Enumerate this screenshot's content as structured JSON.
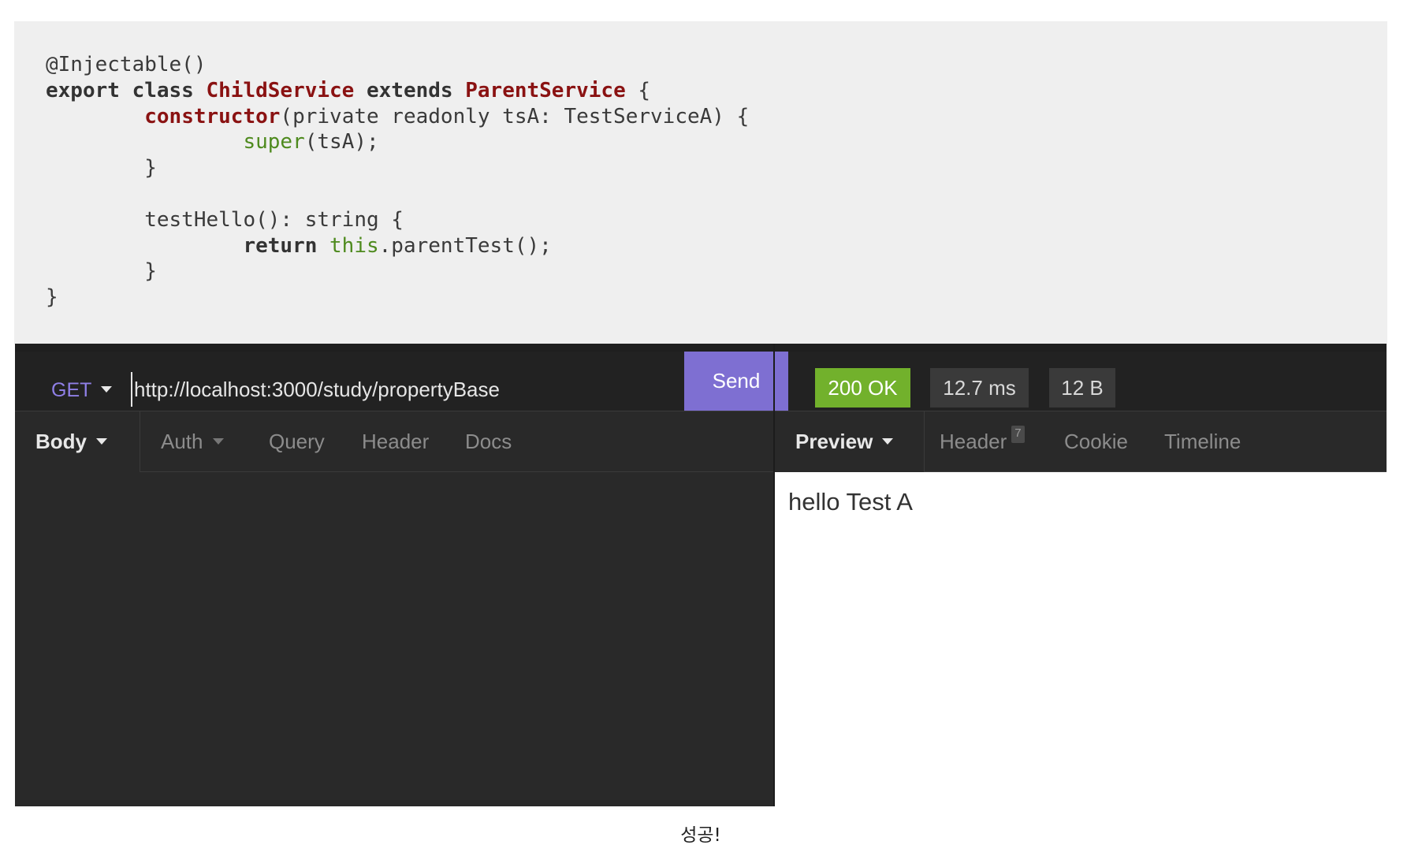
{
  "code": {
    "lines": [
      [
        {
          "t": "@Injectable()",
          "c": ""
        }
      ],
      [
        {
          "t": "export class ",
          "c": "kw"
        },
        {
          "t": "ChildService",
          "c": "cls"
        },
        {
          "t": " extends ",
          "c": "kw"
        },
        {
          "t": "ParentService",
          "c": "cls"
        },
        {
          "t": " {",
          "c": ""
        }
      ],
      [
        {
          "t": "        ",
          "c": ""
        },
        {
          "t": "constructor",
          "c": "fn"
        },
        {
          "t": "(private readonly tsA: TestServiceA) {",
          "c": ""
        }
      ],
      [
        {
          "t": "                ",
          "c": ""
        },
        {
          "t": "super",
          "c": "grn"
        },
        {
          "t": "(tsA);",
          "c": ""
        }
      ],
      [
        {
          "t": "        }",
          "c": ""
        }
      ],
      [
        {
          "t": "",
          "c": ""
        }
      ],
      [
        {
          "t": "        testHello(): string {",
          "c": ""
        }
      ],
      [
        {
          "t": "                ",
          "c": ""
        },
        {
          "t": "return",
          "c": "kw"
        },
        {
          "t": " ",
          "c": ""
        },
        {
          "t": "this",
          "c": "grn"
        },
        {
          "t": ".parentTest();",
          "c": ""
        }
      ],
      [
        {
          "t": "        }",
          "c": ""
        }
      ],
      [
        {
          "t": "}",
          "c": ""
        }
      ]
    ]
  },
  "client": {
    "method": "GET",
    "url": "http://localhost:3000/study/propertyBase",
    "send_label": "Send",
    "status": "200 OK",
    "time": "12.7 ms",
    "size": "12 B",
    "request_tabs": {
      "body": "Body",
      "auth": "Auth",
      "query": "Query",
      "header": "Header",
      "docs": "Docs"
    },
    "response_tabs": {
      "preview": "Preview",
      "header": "Header",
      "header_count": "7",
      "cookie": "Cookie",
      "timeline": "Timeline"
    },
    "response_body": "hello Test A",
    "colors": {
      "method": "#8f7fe6",
      "send": "#7e6fd2",
      "status_ok": "#72b12c"
    }
  },
  "caption": "성공!"
}
